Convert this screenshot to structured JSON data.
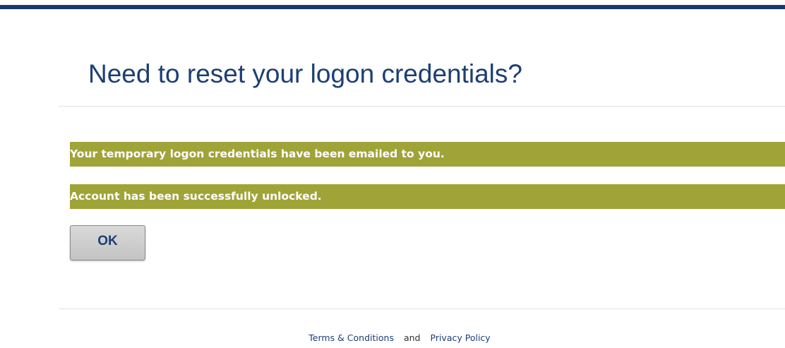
{
  "header": {
    "title": "Need to reset your logon credentials?"
  },
  "messages": [
    {
      "text": "Your temporary logon credentials have been emailed to you."
    },
    {
      "text": "Account has been successfully unlocked."
    }
  ],
  "actions": {
    "ok_label": "OK"
  },
  "footer": {
    "terms_label": "Terms & Conditions",
    "separator": "and",
    "privacy_label": "Privacy Policy"
  },
  "colors": {
    "brand_navy": "#173a6e",
    "title_blue": "#1c3f73",
    "message_bar": "#a0a338",
    "message_text": "#ffffff"
  }
}
